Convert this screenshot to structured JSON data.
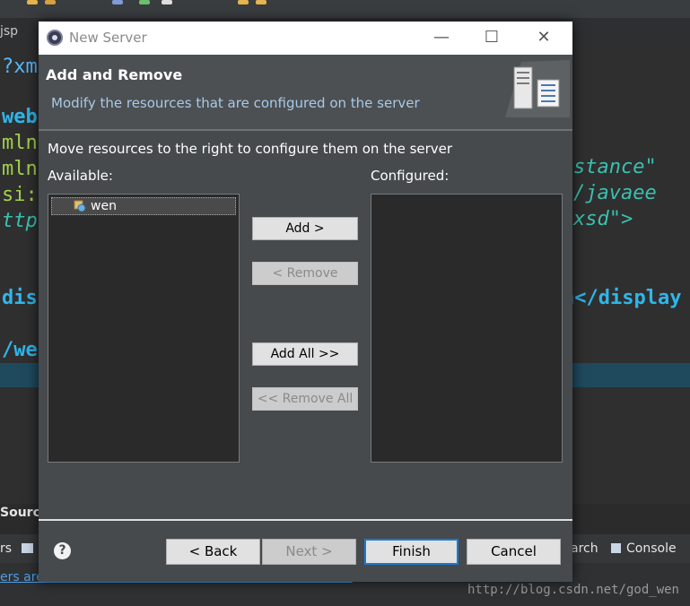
{
  "ide": {
    "tab_label": "jsp",
    "code": {
      "line1": "?xm",
      "line2": "web",
      "line3": "mlns",
      "line4": "mlns",
      "line5": "si:",
      "line6": "ttp",
      "line7_left": "dis",
      "line8": "/we",
      "right1": "stance\"",
      "right2": "/javaee",
      "right3": "xsd\">",
      "right4": "n</display"
    },
    "bottom": {
      "source_tab": "Source",
      "servers_tab": "rs",
      "search_tab": "arch",
      "console_tab": "Console",
      "servers_link": "ers are available. Click this link to create a new server..."
    },
    "watermark": "http://blog.csdn.net/god_wen"
  },
  "dialog": {
    "title": "New Server",
    "window_controls": {
      "minimize": "—",
      "maximize": "☐",
      "close": "✕"
    },
    "header_title": "Add and Remove",
    "header_desc": "Modify the resources that are configured on the server",
    "instructions": "Move resources to the right to configure them on the server",
    "available_label": "Available:",
    "configured_label": "Configured:",
    "available_items": [
      "wen"
    ],
    "buttons": {
      "add": "Add >",
      "remove": "< Remove",
      "add_all": "Add All >>",
      "remove_all": "<< Remove All"
    },
    "help": "?",
    "footer": {
      "back": "< Back",
      "next": "Next >",
      "finish": "Finish",
      "cancel": "Cancel"
    }
  },
  "colors": {
    "dialog_bg": "#464a4d",
    "header_bg": "#4c5053",
    "header_desc": "#a9c9e6",
    "list_bg": "#2a2a2a",
    "focus_border": "#1a7ad4"
  }
}
